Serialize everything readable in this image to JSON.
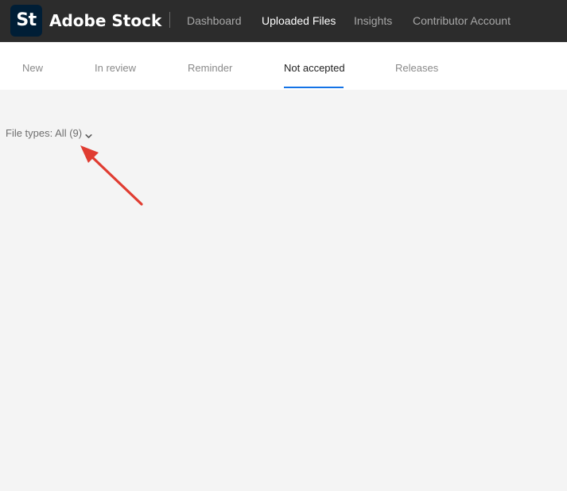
{
  "header": {
    "logo_text": "St",
    "brand": "Adobe Stock",
    "nav": [
      {
        "label": "Dashboard",
        "active": false
      },
      {
        "label": "Uploaded Files",
        "active": true
      },
      {
        "label": "Insights",
        "active": false
      },
      {
        "label": "Contributor Account",
        "active": false
      }
    ]
  },
  "tabs": [
    {
      "label": "New",
      "active": false
    },
    {
      "label": "In review",
      "active": false
    },
    {
      "label": "Reminder",
      "active": false
    },
    {
      "label": "Not accepted",
      "active": true
    },
    {
      "label": "Releases",
      "active": false
    }
  ],
  "filter": {
    "label": "File types: All (9)",
    "icon": "chevron-down-icon"
  },
  "annotation": {
    "type": "arrow",
    "color": "#e03c31",
    "points_to": "file-types-filter"
  },
  "colors": {
    "topbar": "#2c2c2c",
    "logo_bg": "#001e36",
    "accent": "#1473e6",
    "page_bg": "#f4f4f4"
  }
}
